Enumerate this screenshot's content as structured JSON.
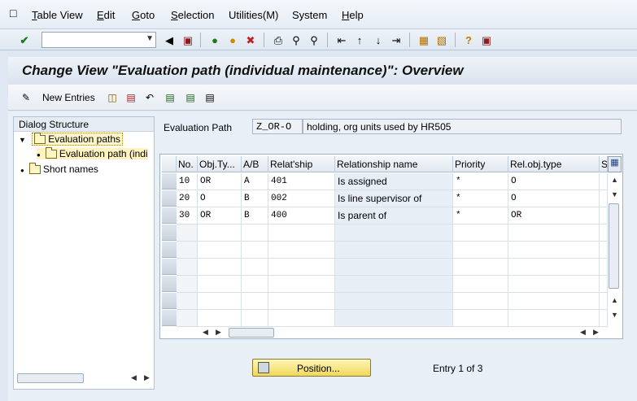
{
  "menu": {
    "items": [
      {
        "label": "Table View",
        "u": "T"
      },
      {
        "label": "Edit",
        "u": "E"
      },
      {
        "label": "Goto",
        "u": "G"
      },
      {
        "label": "Selection",
        "u": "S"
      },
      {
        "label": "Utilities(M)",
        "u": ""
      },
      {
        "label": "System",
        "u": ""
      },
      {
        "label": "Help",
        "u": "H"
      }
    ]
  },
  "title": "Change View \"Evaluation path (individual maintenance)\": Overview",
  "app_toolbar": {
    "new_entries": "New Entries"
  },
  "dialog": {
    "header": "Dialog Structure",
    "items": [
      {
        "label": "Evaluation paths"
      },
      {
        "label": "Evaluation path (indi"
      },
      {
        "label": "Short names"
      }
    ]
  },
  "eval": {
    "label": "Evaluation Path",
    "code": "Z_OR-O",
    "description": "holding, org units used by HR505"
  },
  "table": {
    "headers": [
      "No.",
      "Obj.Ty...",
      "A/B",
      "Relat'ship",
      "Relationship name",
      "Priority",
      "Rel.obj.type",
      "S"
    ],
    "rows": [
      [
        "10",
        "OR",
        "A",
        "401",
        "Is assigned",
        "*",
        "O"
      ],
      [
        "20",
        "O",
        "B",
        "002",
        "Is line supervisor of",
        "*",
        "O"
      ],
      [
        "30",
        "OR",
        "B",
        "400",
        "Is parent of",
        "*",
        "OR"
      ]
    ]
  },
  "position_button": "Position...",
  "entry_info": "Entry 1 of 3",
  "colors": {
    "title_text": "#111111",
    "button_yellow": "#f0d85a",
    "selected_tree": "#fff6c8"
  }
}
